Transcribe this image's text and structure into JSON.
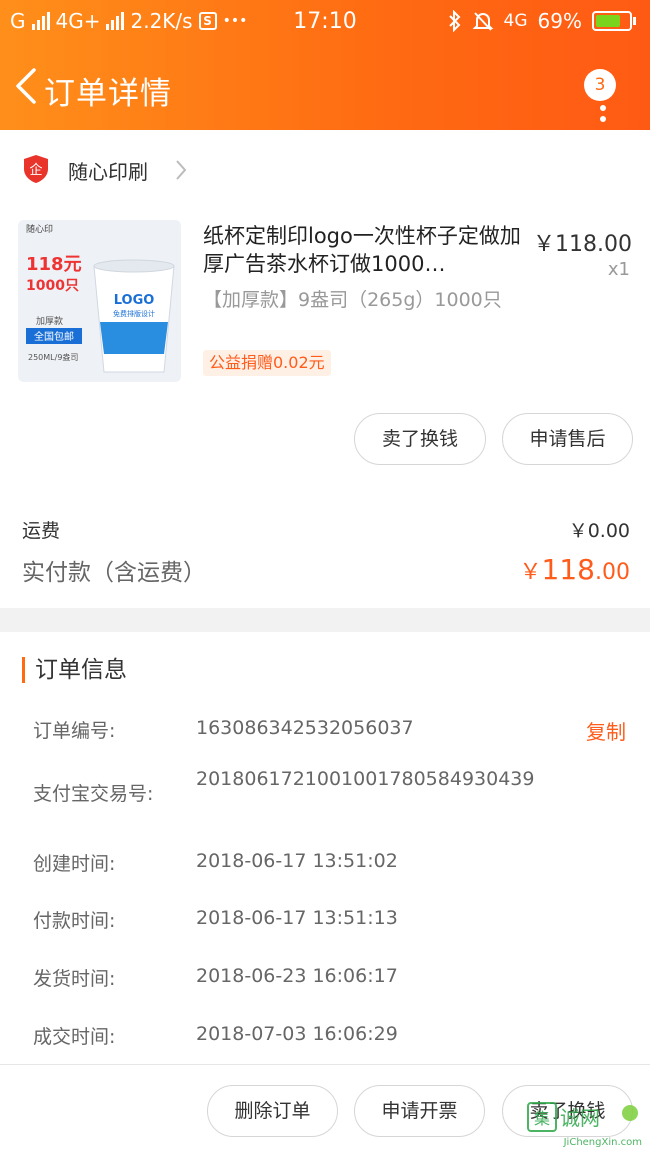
{
  "status_bar": {
    "carrier": "G",
    "network": "4G+",
    "speed": "2.2K/s",
    "s_icon": "S",
    "dots": "•••",
    "time": "17:10",
    "network2": "4G",
    "battery": "69%"
  },
  "header": {
    "title": "订单详情",
    "badge": "3"
  },
  "shop": {
    "name": "随心印刷"
  },
  "product": {
    "title": "纸杯定制印logo一次性杯子定做加厚广告茶水杯订做1000…",
    "spec": "【加厚款】9盎司（265g）1000只",
    "tag": "公益捐赠0.02元",
    "price": "￥118.00",
    "qty": "x1",
    "thumb": {
      "brand": "随心印",
      "price_big": "118元",
      "count": "1000只",
      "variant": "加厚款",
      "shipping": "全国包邮",
      "size": "250ML/9盎司",
      "cup_logo": "LOGO",
      "cup_sub": "免费排版设计"
    }
  },
  "actions": {
    "sell": "卖了换钱",
    "after_sale": "申请售后"
  },
  "fees": {
    "freight_label": "运费",
    "freight_value": "￥0.00",
    "paid_label": "实付款（含运费）",
    "paid_currency": "￥",
    "paid_int": "118",
    "paid_dec": ".00"
  },
  "order_info": {
    "title": "订单信息",
    "copy": "复制",
    "rows": [
      {
        "label": "订单编号:",
        "value": "163086342532056037"
      },
      {
        "label": "支付宝交易号:",
        "value": "2018061721001001780584930439"
      },
      {
        "label": "创建时间:",
        "value": "2018-06-17 13:51:02"
      },
      {
        "label": "付款时间:",
        "value": "2018-06-17 13:51:13"
      },
      {
        "label": "发货时间:",
        "value": "2018-06-23 16:06:17"
      },
      {
        "label": "成交时间:",
        "value": "2018-07-03 16:06:29"
      }
    ]
  },
  "footer": {
    "delete": "删除订单",
    "invoice": "申请开票",
    "sell": "卖了换钱"
  },
  "watermark": {
    "text": "JiChengXin.com"
  },
  "colors": {
    "accent": "#ff6a12",
    "price_orange": "#ff5c1c"
  }
}
